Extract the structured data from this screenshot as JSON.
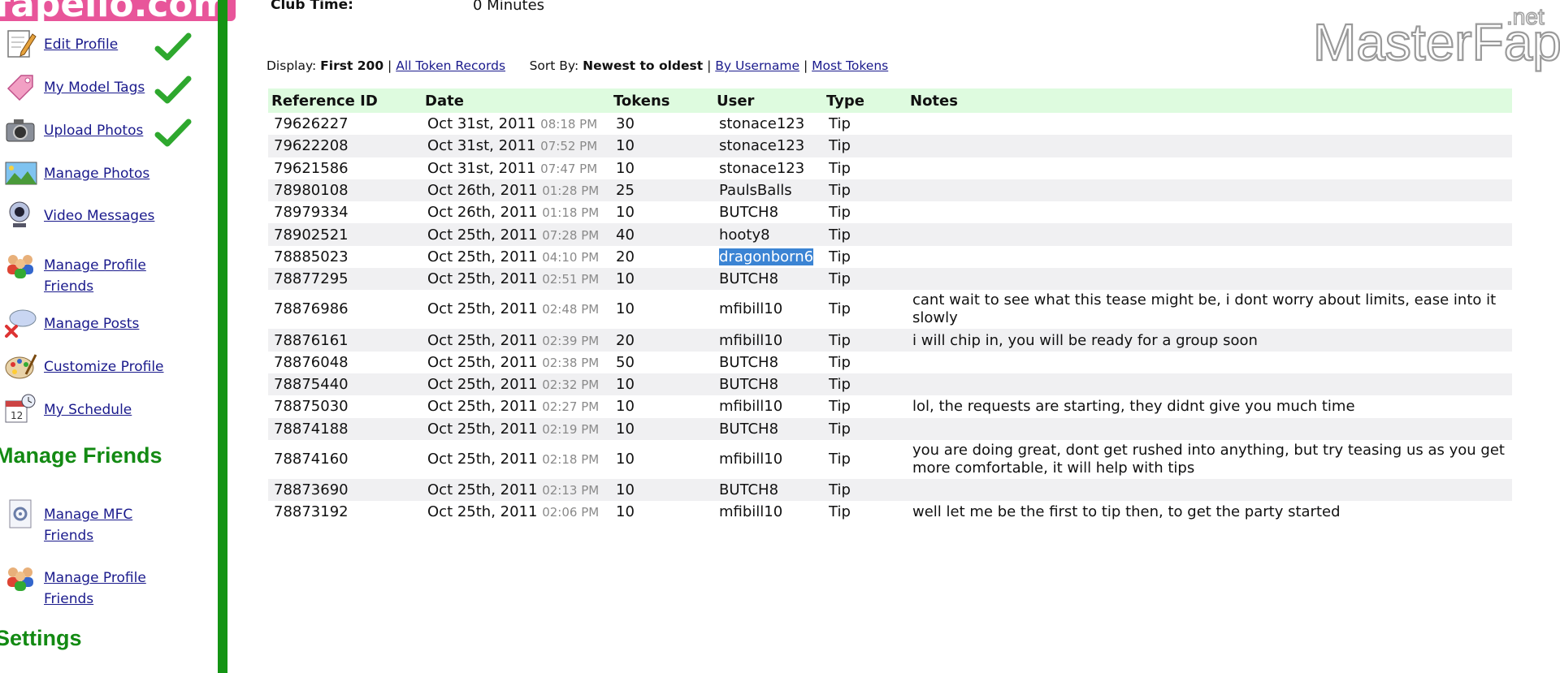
{
  "header": {
    "site_logo_text": "fapello.com",
    "club_time_label": "Club Time:",
    "club_time_value": "0 Minutes",
    "watermark_main": "MasterFap",
    "watermark_suffix": ".net"
  },
  "sidebar": {
    "items": [
      {
        "label": "Edit Profile",
        "icon": "edit-profile-icon",
        "checked": true
      },
      {
        "label": "My Model Tags",
        "icon": "tag-icon",
        "checked": true
      },
      {
        "label": "Upload Photos",
        "icon": "camera-icon",
        "checked": true
      },
      {
        "label": "Manage Photos",
        "icon": "photo-icon",
        "checked": false
      },
      {
        "label": "Video Messages",
        "icon": "webcam-icon",
        "checked": false
      },
      {
        "label": "Manage Profile Friends",
        "icon": "friends-icon",
        "checked": false
      },
      {
        "label": "Manage Posts",
        "icon": "posts-icon",
        "checked": false
      },
      {
        "label": "Customize Profile",
        "icon": "palette-icon",
        "checked": false
      },
      {
        "label": "My Schedule",
        "icon": "calendar-icon",
        "checked": false
      }
    ],
    "section_friends": "Manage Friends",
    "friends_items": [
      {
        "label": "Manage MFC Friends",
        "icon": "gear-document-icon"
      },
      {
        "label": "Manage Profile Friends",
        "icon": "friends-icon"
      }
    ],
    "section_settings": "Settings"
  },
  "toolbar": {
    "display_label": "Display:",
    "display_selected": "First 200",
    "separator": "|",
    "all_records_link": "All Token Records",
    "sort_label": "Sort By:",
    "sort_selected": "Newest to oldest",
    "by_username_link": "By Username",
    "most_tokens_link": "Most Tokens"
  },
  "table": {
    "columns": [
      "Reference ID",
      "Date",
      "Tokens",
      "User",
      "Type",
      "Notes"
    ],
    "rows": [
      {
        "ref": "79626227",
        "date": "Oct 31st, 2011",
        "time": "08:18 PM",
        "tokens": "30",
        "user": "stonace123",
        "type": "Tip",
        "notes": ""
      },
      {
        "ref": "79622208",
        "date": "Oct 31st, 2011",
        "time": "07:52 PM",
        "tokens": "10",
        "user": "stonace123",
        "type": "Tip",
        "notes": ""
      },
      {
        "ref": "79621586",
        "date": "Oct 31st, 2011",
        "time": "07:47 PM",
        "tokens": "10",
        "user": "stonace123",
        "type": "Tip",
        "notes": ""
      },
      {
        "ref": "78980108",
        "date": "Oct 26th, 2011",
        "time": "01:28 PM",
        "tokens": "25",
        "user": "PaulsBalls",
        "type": "Tip",
        "notes": ""
      },
      {
        "ref": "78979334",
        "date": "Oct 26th, 2011",
        "time": "01:18 PM",
        "tokens": "10",
        "user": "BUTCH8",
        "type": "Tip",
        "notes": ""
      },
      {
        "ref": "78902521",
        "date": "Oct 25th, 2011",
        "time": "07:28 PM",
        "tokens": "40",
        "user": "hooty8",
        "type": "Tip",
        "notes": ""
      },
      {
        "ref": "78885023",
        "date": "Oct 25th, 2011",
        "time": "04:10 PM",
        "tokens": "20",
        "user": "dragonborn6",
        "type": "Tip",
        "notes": "",
        "selected": true
      },
      {
        "ref": "78877295",
        "date": "Oct 25th, 2011",
        "time": "02:51 PM",
        "tokens": "10",
        "user": "BUTCH8",
        "type": "Tip",
        "notes": ""
      },
      {
        "ref": "78876986",
        "date": "Oct 25th, 2011",
        "time": "02:48 PM",
        "tokens": "10",
        "user": "mfibill10",
        "type": "Tip",
        "notes": "cant wait to see what this tease might be, i dont worry about limits, ease into it slowly"
      },
      {
        "ref": "78876161",
        "date": "Oct 25th, 2011",
        "time": "02:39 PM",
        "tokens": "20",
        "user": "mfibill10",
        "type": "Tip",
        "notes": "i will chip in, you will be ready for a group soon"
      },
      {
        "ref": "78876048",
        "date": "Oct 25th, 2011",
        "time": "02:38 PM",
        "tokens": "50",
        "user": "BUTCH8",
        "type": "Tip",
        "notes": ""
      },
      {
        "ref": "78875440",
        "date": "Oct 25th, 2011",
        "time": "02:32 PM",
        "tokens": "10",
        "user": "BUTCH8",
        "type": "Tip",
        "notes": ""
      },
      {
        "ref": "78875030",
        "date": "Oct 25th, 2011",
        "time": "02:27 PM",
        "tokens": "10",
        "user": "mfibill10",
        "type": "Tip",
        "notes": "lol, the requests are starting, they didnt give you much time"
      },
      {
        "ref": "78874188",
        "date": "Oct 25th, 2011",
        "time": "02:19 PM",
        "tokens": "10",
        "user": "BUTCH8",
        "type": "Tip",
        "notes": ""
      },
      {
        "ref": "78874160",
        "date": "Oct 25th, 2011",
        "time": "02:18 PM",
        "tokens": "10",
        "user": "mfibill10",
        "type": "Tip",
        "notes": "you are doing great, dont get rushed into anything, but try teasing us as you get more comfortable, it will help with tips"
      },
      {
        "ref": "78873690",
        "date": "Oct 25th, 2011",
        "time": "02:13 PM",
        "tokens": "10",
        "user": "BUTCH8",
        "type": "Tip",
        "notes": ""
      },
      {
        "ref": "78873192",
        "date": "Oct 25th, 2011",
        "time": "02:06 PM",
        "tokens": "10",
        "user": "mfibill10",
        "type": "Tip",
        "notes": "well let me be the first to tip then, to get the party started"
      }
    ]
  },
  "colors": {
    "sidebar_border": "#149414",
    "section_heading": "#138a13",
    "header_row": "#defbdf",
    "stripe": "#f0f0f2",
    "link": "#1a1a8c",
    "selection": "#3b84d4",
    "site_logo_bg": "#e8559a"
  }
}
